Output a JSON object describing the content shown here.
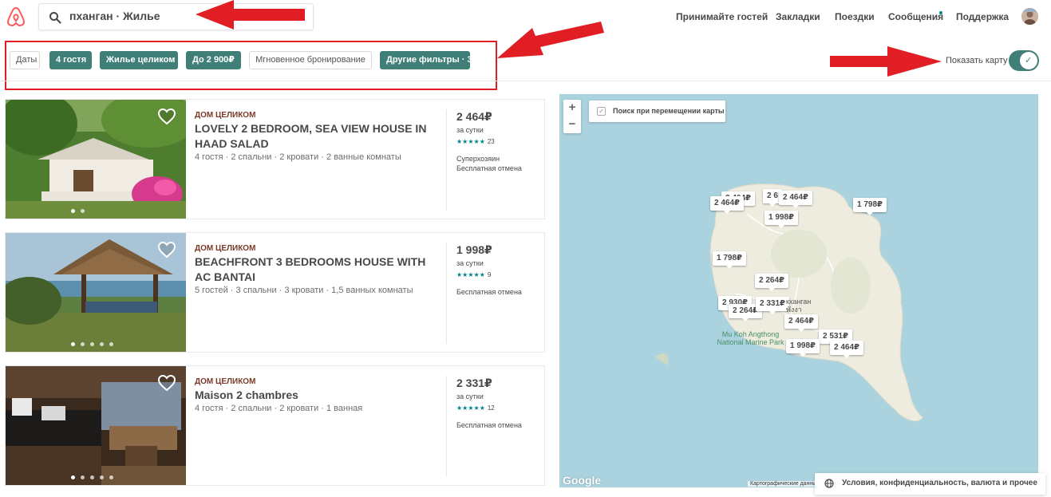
{
  "header": {
    "search_text": "пханган · Жилье",
    "nav": [
      "Принимайте гостей",
      "Закладки",
      "Поездки",
      "Сообщения",
      "Поддержка"
    ]
  },
  "filters": {
    "chips": [
      {
        "label": "Даты",
        "active": false
      },
      {
        "label": "4 гостя",
        "active": true
      },
      {
        "label": "Жилье целиком",
        "active": true
      },
      {
        "label": "До 2 900₽",
        "active": true
      },
      {
        "label": "Мгновенное бронирование",
        "active": false
      },
      {
        "label": "Другие фильтры · 3",
        "active": true
      }
    ],
    "map_toggle_label": "Показать карту",
    "map_toggle_on": true
  },
  "listings": [
    {
      "type": "ДОМ ЦЕЛИКОМ",
      "title": "LOVELY 2 BEDROOM, SEA VIEW HOUSE IN HAAD SALAD",
      "meta": "4 гостя · 2 спальни · 2 кровати · 2 ванные комнаты",
      "price": "2 464₽",
      "per": "за сутки",
      "stars": "★★★★★",
      "reviews": "23",
      "notes": [
        "Суперхозяин",
        "Бесплатная отмена"
      ],
      "photos": 2,
      "active_photo": 0
    },
    {
      "type": "ДОМ ЦЕЛИКОМ",
      "title": "BEACHFRONT 3 BEDROOMS HOUSE WITH AC BANTAI",
      "meta": "5 гостей · 3 спальни · 3 кровати · 1,5 ванных комнаты",
      "price": "1 998₽",
      "per": "за сутки",
      "stars": "★★★★★",
      "reviews": "9",
      "notes": [
        "Бесплатная отмена"
      ],
      "photos": 5,
      "active_photo": 0
    },
    {
      "type": "ДОМ ЦЕЛИКОМ",
      "title": "Maison 2 chambres",
      "meta": "4 гостя · 2 спальни · 2 кровати · 1 ванная",
      "price": "2 331₽",
      "per": "за сутки",
      "stars": "★★★★★",
      "reviews": "12",
      "notes": [
        "Бесплатная отмена"
      ],
      "photos": 5,
      "active_photo": 0
    }
  ],
  "map": {
    "zoom_in": "+",
    "zoom_out": "−",
    "search_on_move_label": "Поиск при перемещении карты",
    "markers": [
      "2 464₽",
      "2 464₽",
      "2 6",
      "2 464₽",
      "1 998₽",
      "1 798₽",
      "1 798₽",
      "2 264₽",
      "2 930₽",
      "2 264₽",
      "2 331₽",
      "2 464₽",
      "2 531₽",
      "1 998₽",
      "2 464₽"
    ],
    "place_label": "Mu Koh Angthong National Marine Park",
    "town_label": "кханган",
    "town_label_thai": "พังงา",
    "google": "Google",
    "attribution": "Картографические данные"
  },
  "footer": {
    "label": "Условия, конфиденциальность, валюта и прочее"
  },
  "colors": {
    "brand": "#FF5A5F",
    "accent": "#3F7F78",
    "annotation_arrow": "#E01E24"
  }
}
